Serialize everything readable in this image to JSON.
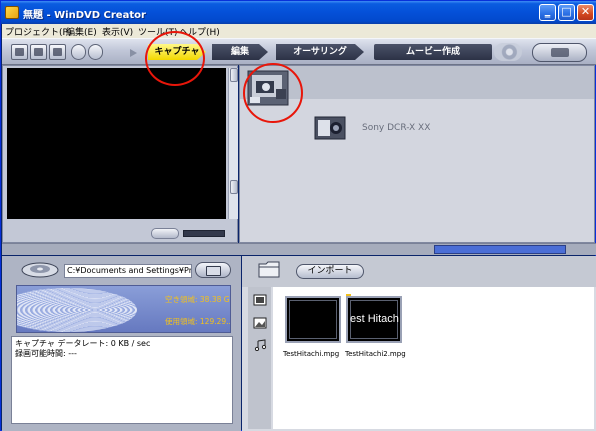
{
  "window": {
    "title": "無題 - WinDVD Creator",
    "controls": {
      "minimize": "‗",
      "maximize": "□",
      "close": "✕"
    }
  },
  "menu": {
    "items": [
      "プロジェクト(P)",
      "編集(E)",
      "表示(V)",
      "ツール(T)",
      "ヘルプ(H)"
    ]
  },
  "toolbar": {
    "tabs": {
      "capture": "キャプチャ",
      "edit": "編集",
      "authoring": "オーサリング",
      "movie_create": "ムービー作成"
    }
  },
  "device": {
    "name": "Sony DCR-X XX"
  },
  "capture_info": {
    "path": "C:¥Documents and Settings¥Prius¥...",
    "free_space_label": "空き領域: 38.38 GB",
    "used_space_label": "使用領域: 129.29...",
    "data_rate": "キャプチャ データレート: 0 KB / sec",
    "recordable_time": "録画可能時間: ---"
  },
  "library": {
    "import_label": "インポート",
    "items": [
      {
        "filename": "TestHitachi.mpg",
        "overlay": ""
      },
      {
        "filename": "TestHitachi2.mpg",
        "overlay": "est Hitach"
      }
    ]
  },
  "colors": {
    "annotation": "#e8160a",
    "active_tab": "#f3d800",
    "title_bar": "#0450d8"
  },
  "icons": [
    "app-icon",
    "new-project-icon",
    "open-project-icon",
    "save-project-icon",
    "undo-icon",
    "redo-icon",
    "disc-icon",
    "camcorder-icon",
    "hdd-icon",
    "folder-icon",
    "video-filter-icon",
    "image-filter-icon",
    "audio-filter-icon"
  ]
}
